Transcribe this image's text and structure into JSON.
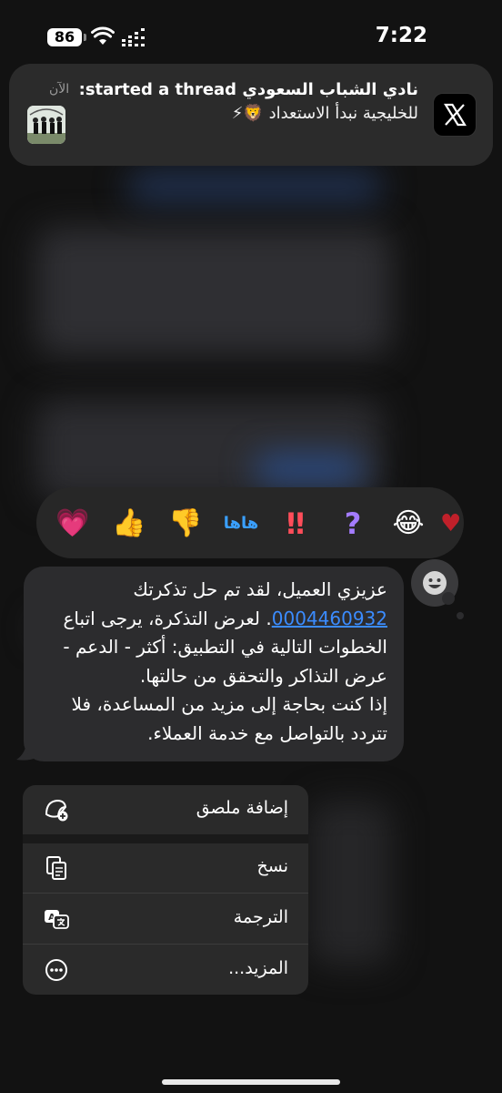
{
  "status_bar": {
    "battery": "86",
    "time": "7:22"
  },
  "notification": {
    "title": "نادي الشباب السعودي started a thread:",
    "body": "للخليجية نبدأ الاستعداد 🦁⚡",
    "time": "الآن",
    "app_icon": "x-logo-icon"
  },
  "reactions": {
    "items": [
      {
        "name": "heart",
        "glyph": "💗"
      },
      {
        "name": "thumbs-up",
        "glyph": "👍"
      },
      {
        "name": "thumbs-down",
        "glyph": "👎"
      },
      {
        "name": "haha",
        "glyph": "هاها"
      },
      {
        "name": "exclamation",
        "glyph": "‼"
      },
      {
        "name": "question",
        "glyph": "?"
      },
      {
        "name": "laugh",
        "glyph": "😂"
      }
    ]
  },
  "message": {
    "line1": "عزيزي العميل، لقد تم حل تذكرتك",
    "ticket_number": "0004460932",
    "line2_rest": ". لعرض التذكرة، يرجى اتباع",
    "line3": "الخطوات التالية في التطبيق: أكثر - الدعم -",
    "line4": "عرض التذاكر والتحقق من حالتها.",
    "line5": "إذا كنت بحاجة إلى مزيد من المساعدة، فلا",
    "line6": "تتردد بالتواصل مع خدمة العملاء."
  },
  "menu": {
    "add_sticker": "إضافة ملصق",
    "copy": "نسخ",
    "translate": "الترجمة",
    "more": "المزيد..."
  },
  "colors": {
    "link": "#3b8cff",
    "bubble": "#2c2c2e",
    "menu": "#2a2a2a"
  }
}
